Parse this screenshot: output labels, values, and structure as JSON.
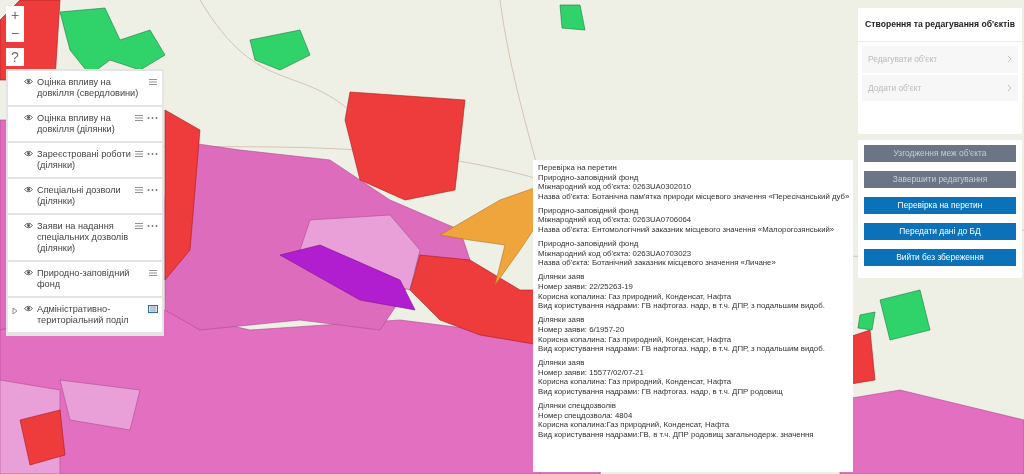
{
  "zoom_controls": [
    "+",
    "−",
    "?"
  ],
  "layers": [
    {
      "title": "Оцінка впливу на довкілля (свердловини)",
      "visible": true,
      "has_options": false,
      "expandable": false,
      "legend_open": false
    },
    {
      "title": "Оцінка впливу на довкілля (ділянки)",
      "visible": true,
      "has_options": true,
      "expandable": false,
      "legend_open": false
    },
    {
      "title": "Зареєстровані роботи (ділянки)",
      "visible": true,
      "has_options": true,
      "expandable": false,
      "legend_open": false
    },
    {
      "title": "Спеціальні дозволи (ділянки)",
      "visible": true,
      "has_options": true,
      "expandable": false,
      "legend_open": false
    },
    {
      "title": "Заяви на надання спеціальних дозволів (ділянки)",
      "visible": true,
      "has_options": true,
      "expandable": false,
      "legend_open": false
    },
    {
      "title": "Природно-заповідний фонд",
      "visible": true,
      "has_options": false,
      "expandable": false,
      "legend_open": false
    },
    {
      "title": "Адміністративно-територіальний поділ",
      "visible": true,
      "has_options": false,
      "expandable": true,
      "legend_open": true
    }
  ],
  "popup": {
    "title": "Перевірка на перетин",
    "groups": [
      {
        "heading": "Природно-заповідний фонд",
        "lines": [
          "Міжнародний код об'єкта: 0263UA0302010",
          "Назва об'єкта: Ботанічна пам'ятка природи місцевого значення «Пересічанський дуб»"
        ]
      },
      {
        "heading": "Природно-заповідний фонд",
        "lines": [
          "Міжнародний код об'єкта: 0263UA0706064",
          "Назва об'єкта: Ентомологічний заказник місцевого значення «Малорогозянський»"
        ]
      },
      {
        "heading": "Природно-заповідний фонд",
        "lines": [
          "Міжнародний код об'єкта: 0263UA0703023",
          "Назва об'єкта: Ботанічний заказник місцевого значення «Личане»"
        ]
      },
      {
        "heading": "Ділянки заяв",
        "lines": [
          "Номер заяви: 22/25263-19",
          "Корисна копалина: Газ природний, Конденсат, Нафта",
          "Вид користування надрами: ГВ нафтогаз. надр, в т.ч. ДПР, з подальшим видоб."
        ]
      },
      {
        "heading": "Ділянки заяв",
        "lines": [
          "Номер заяви: 6/1957-20",
          "Корисна копалина: Газ природний, Конденсат, Нафта",
          "Вид користування надрами: ГВ нафтогаз. надр, в т.ч. ДПР, з подальшим видоб."
        ]
      },
      {
        "heading": "Ділянки заяв",
        "lines": [
          "Номер заяви: 15577/02/07-21",
          "Корисна копалина: Газ природний, Конденсат, Нафта",
          "Вид користування надрами: ГВ нафтогаз. надр, в т.ч. ДПР родовищ"
        ]
      },
      {
        "heading": "Ділянки спецдозволів",
        "lines": [
          "Номер спецдозвола: 4804",
          "Корисна копалина:Газ природний, Конденсат, Нафта",
          "Вид користування надрами:ГВ, в т.ч. ДПР родовищ загальнодерж. значення"
        ]
      }
    ]
  },
  "editor": {
    "title": "Створення та редагування об'єктів",
    "items": [
      {
        "label": "Редагувати об'єкт",
        "disabled": true
      },
      {
        "label": "Додати об'єкт",
        "disabled": true
      }
    ],
    "buttons": [
      {
        "label": "Узгодження меж об'єкта",
        "disabled": true
      },
      {
        "label": "Завершити редагування",
        "disabled": true
      },
      {
        "label": "Перевірка на перетин",
        "disabled": false
      },
      {
        "label": "Передати дані до БД",
        "disabled": false
      },
      {
        "label": "Вийти без збереження",
        "disabled": false
      }
    ]
  }
}
